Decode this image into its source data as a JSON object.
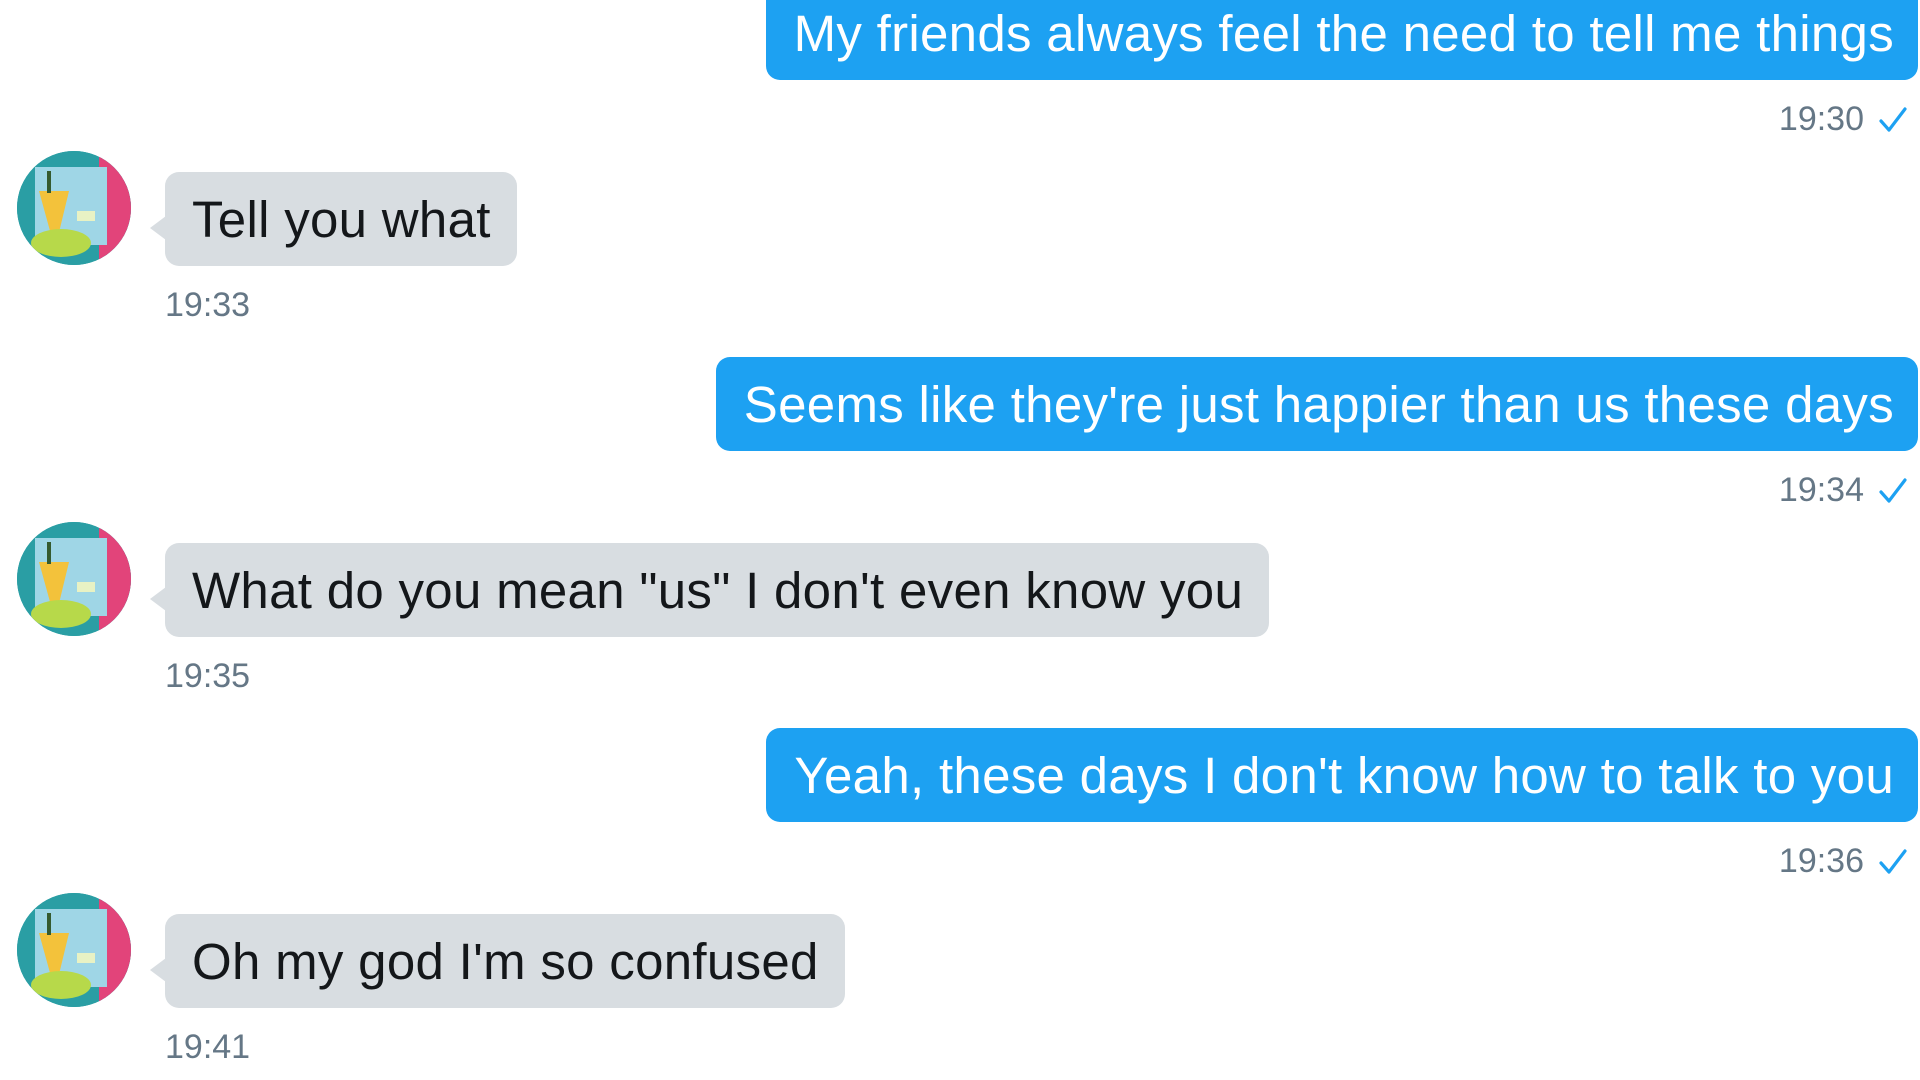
{
  "conversation": {
    "messages": [
      {
        "from": "me",
        "text": "My friends always feel the need to tell me things",
        "time": "19:30"
      },
      {
        "from": "other",
        "text": "Tell you what",
        "time": "19:33"
      },
      {
        "from": "me",
        "text": "Seems like they're just happier than us these days",
        "time": "19:34"
      },
      {
        "from": "other",
        "text": "What do you mean \"us\" I don't even know you",
        "time": "19:35"
      },
      {
        "from": "me",
        "text": "Yeah, these days I don't know how to talk to you",
        "time": "19:36"
      },
      {
        "from": "other",
        "text": "Oh my god I'm so confused",
        "time": "19:41"
      }
    ]
  },
  "colors": {
    "sent_bubble": "#1da1f2",
    "received_bubble": "#d8dde1",
    "timestamp": "#657786",
    "read_check": "#1da1f2"
  },
  "icons": {
    "read_receipt": "check-icon",
    "contact_avatar": "avatar"
  }
}
